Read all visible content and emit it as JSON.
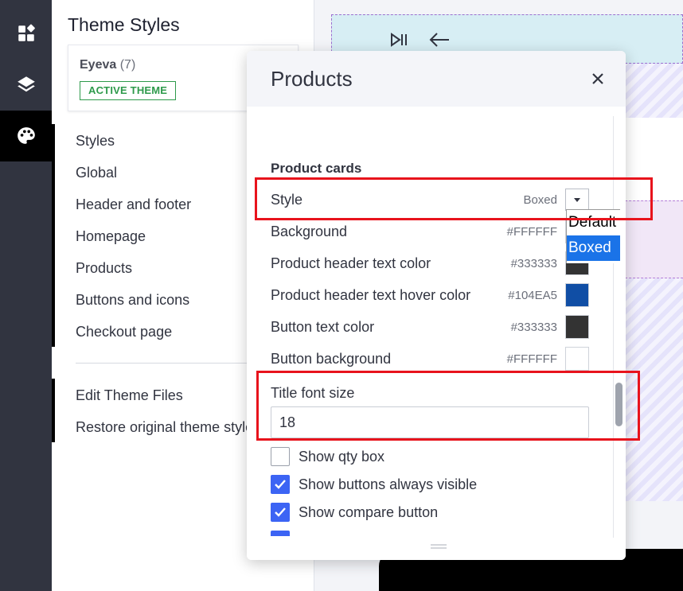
{
  "rail": {
    "items": [
      {
        "icon": "widgets-icon"
      },
      {
        "icon": "layers-icon"
      },
      {
        "icon": "palette-icon"
      }
    ]
  },
  "panel": {
    "title": "Theme Styles",
    "theme": {
      "name": "Eyeva",
      "count": "(7)",
      "badge": "ACTIVE THEME"
    },
    "nav": [
      "Styles",
      "Global",
      "Header and footer",
      "Homepage",
      "Products",
      "Buttons and icons",
      "Checkout page"
    ],
    "nav2": [
      "Edit Theme Files",
      "Restore original theme styles"
    ]
  },
  "modal": {
    "title": "Products",
    "section": "Product cards",
    "style_row": {
      "label": "Style",
      "value": "Boxed"
    },
    "style_options": [
      "Default",
      "Boxed"
    ],
    "color_rows": [
      {
        "label": "Background",
        "value": "#FFFFFF",
        "swatch": "#FFFFFF"
      },
      {
        "label": "Product header text color",
        "value": "#333333",
        "swatch": "#333333"
      },
      {
        "label": "Product header text hover color",
        "value": "#104EA5",
        "swatch": "#104EA5"
      },
      {
        "label": "Button text color",
        "value": "#333333",
        "swatch": "#333333"
      },
      {
        "label": "Button background",
        "value": "#FFFFFF",
        "swatch": "#FFFFFF"
      }
    ],
    "font_size": {
      "label": "Title font size",
      "value": "18"
    },
    "checkboxes": [
      {
        "label": "Show qty box",
        "checked": false
      },
      {
        "label": "Show buttons always visible",
        "checked": true
      },
      {
        "label": "Show compare button",
        "checked": true
      }
    ]
  },
  "colors": {
    "accent": "#3c64f4",
    "active_badge": "#2e9a4b",
    "highlight": "#e8131c",
    "rail": "#313440"
  }
}
